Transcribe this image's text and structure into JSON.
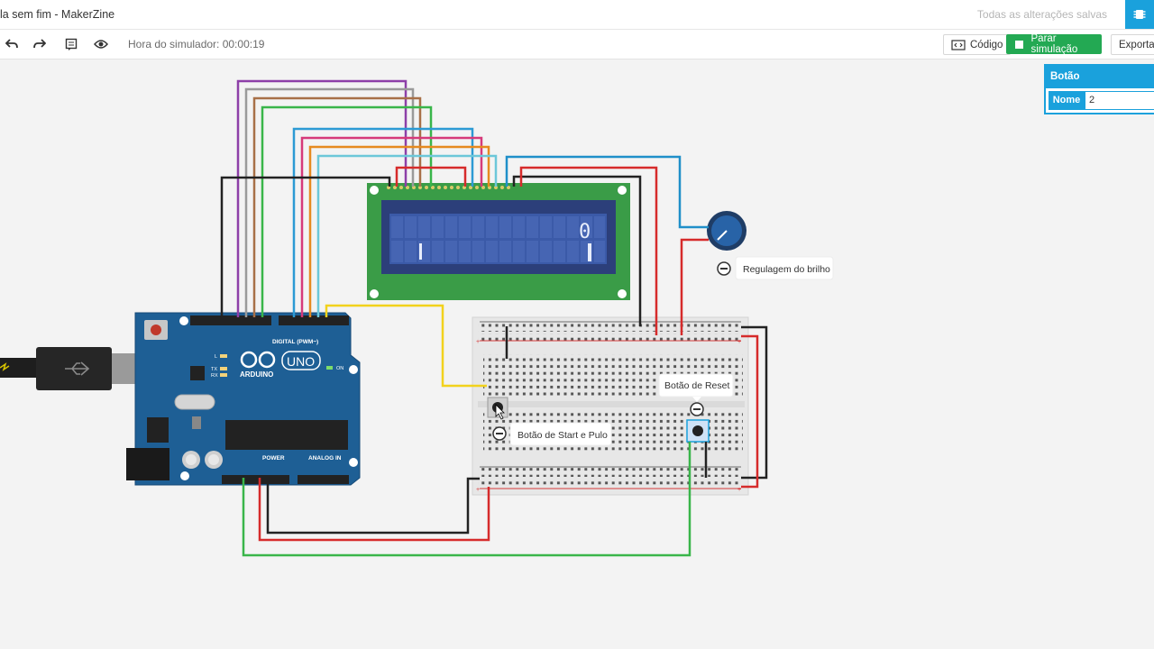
{
  "header": {
    "title": "la sem fim - MakerZine",
    "saved_status": "Todas as alterações salvas"
  },
  "toolbar": {
    "sim_time": "Hora do simulador: 00:00:19",
    "code_label": "Código",
    "stop_label": "Parar simulação",
    "export_label": "Exportar"
  },
  "properties": {
    "title": "Botão",
    "name_label": "Nome",
    "name_value": "2"
  },
  "annotations": {
    "brightness": "Regulagem do brilho",
    "reset": "Botão de Reset",
    "start": "Botão de Start e Pulo"
  },
  "lcd": {
    "digit": "0"
  },
  "arduino": {
    "brand": "ARDUINO",
    "model": "UNO",
    "digital_label": "DIGITAL (PWM~)",
    "power_label": "POWER",
    "analog_label": "ANALOG IN",
    "on_label": "ON",
    "tx_label": "TX",
    "rx_label": "RX",
    "l_label": "L"
  },
  "colors": {
    "accent": "#1aa1dc",
    "run_green": "#23a953",
    "arduino_blue": "#1e5f95",
    "lcd_green": "#3a9c47",
    "lcd_screen": "#3b5aa8"
  }
}
